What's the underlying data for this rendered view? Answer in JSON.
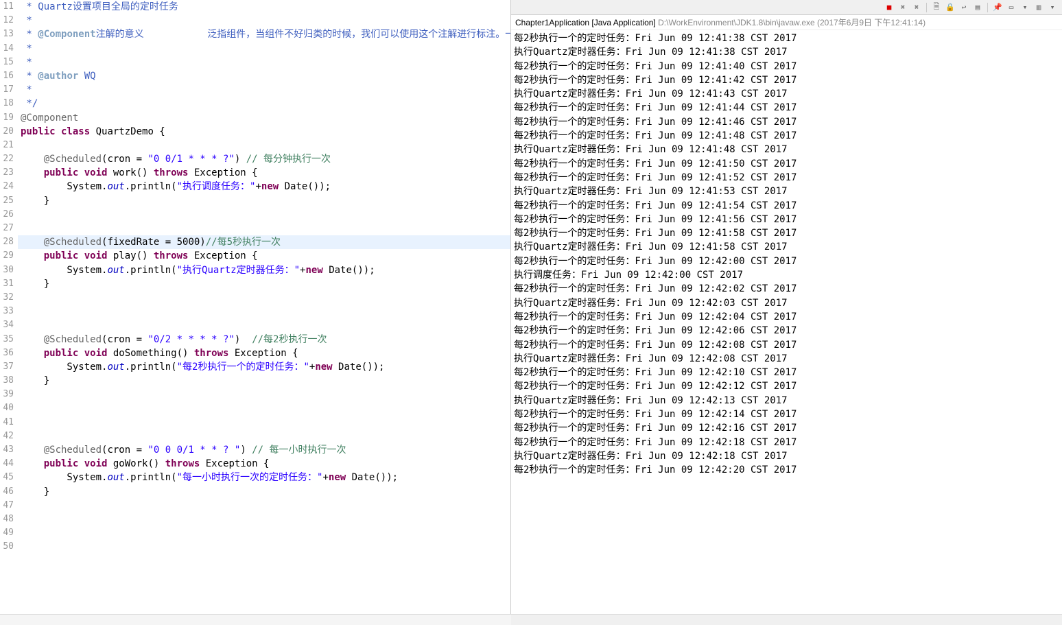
{
  "gutter": {
    "start": 11,
    "end": 50
  },
  "code": [
    {
      "n": 11,
      "segs": [
        {
          "c": "jd",
          "t": " * Quartz设置项目全局的定时任务"
        }
      ]
    },
    {
      "n": 12,
      "segs": [
        {
          "c": "jd",
          "t": " * "
        }
      ]
    },
    {
      "n": 13,
      "segs": [
        {
          "c": "jd",
          "t": " * "
        },
        {
          "c": "jdtag",
          "t": "@Component"
        },
        {
          "c": "jd",
          "t": "注解的意义           泛指组件，当组件不好归类的时候，我们可以使用这个注解进行标注。一般"
        }
      ]
    },
    {
      "n": 14,
      "segs": [
        {
          "c": "jd",
          "t": " * "
        }
      ]
    },
    {
      "n": 15,
      "segs": [
        {
          "c": "jd",
          "t": " * "
        }
      ]
    },
    {
      "n": 16,
      "segs": [
        {
          "c": "jd",
          "t": " * "
        },
        {
          "c": "jdtag",
          "t": "@author"
        },
        {
          "c": "jd",
          "t": " WQ"
        }
      ]
    },
    {
      "n": 17,
      "segs": [
        {
          "c": "jd",
          "t": " *"
        }
      ]
    },
    {
      "n": 18,
      "segs": [
        {
          "c": "jd",
          "t": " */"
        }
      ]
    },
    {
      "n": 19,
      "segs": [
        {
          "c": "ann",
          "t": "@Component"
        }
      ]
    },
    {
      "n": 20,
      "segs": [
        {
          "c": "kw",
          "t": "public class"
        },
        {
          "c": "plain",
          "t": " QuartzDemo {"
        }
      ]
    },
    {
      "n": 21,
      "segs": []
    },
    {
      "n": 22,
      "segs": [
        {
          "c": "plain",
          "t": "    "
        },
        {
          "c": "ann",
          "t": "@Scheduled"
        },
        {
          "c": "plain",
          "t": "(cron = "
        },
        {
          "c": "str",
          "t": "\"0 0/1 * * * ?\""
        },
        {
          "c": "plain",
          "t": ") "
        },
        {
          "c": "cmt",
          "t": "// 每分钟执行一次"
        }
      ]
    },
    {
      "n": 23,
      "segs": [
        {
          "c": "plain",
          "t": "    "
        },
        {
          "c": "kw",
          "t": "public void"
        },
        {
          "c": "plain",
          "t": " work() "
        },
        {
          "c": "kw",
          "t": "throws"
        },
        {
          "c": "plain",
          "t": " Exception {"
        }
      ]
    },
    {
      "n": 24,
      "segs": [
        {
          "c": "plain",
          "t": "        System."
        },
        {
          "c": "itl",
          "t": "out"
        },
        {
          "c": "plain",
          "t": ".println("
        },
        {
          "c": "str",
          "t": "\"执行调度任务：\""
        },
        {
          "c": "plain",
          "t": "+"
        },
        {
          "c": "kw",
          "t": "new"
        },
        {
          "c": "plain",
          "t": " Date());"
        }
      ]
    },
    {
      "n": 25,
      "segs": [
        {
          "c": "plain",
          "t": "    }"
        }
      ]
    },
    {
      "n": 26,
      "segs": []
    },
    {
      "n": 27,
      "segs": []
    },
    {
      "n": 28,
      "hl": true,
      "segs": [
        {
          "c": "plain",
          "t": "    "
        },
        {
          "c": "ann",
          "t": "@Scheduled"
        },
        {
          "c": "plain",
          "t": "(fixedRate = 5000)"
        },
        {
          "c": "cmt",
          "t": "//每5秒执行一次"
        }
      ]
    },
    {
      "n": 29,
      "segs": [
        {
          "c": "plain",
          "t": "    "
        },
        {
          "c": "kw",
          "t": "public void"
        },
        {
          "c": "plain",
          "t": " play() "
        },
        {
          "c": "kw",
          "t": "throws"
        },
        {
          "c": "plain",
          "t": " Exception {"
        }
      ]
    },
    {
      "n": 30,
      "segs": [
        {
          "c": "plain",
          "t": "        System."
        },
        {
          "c": "itl",
          "t": "out"
        },
        {
          "c": "plain",
          "t": ".println("
        },
        {
          "c": "str",
          "t": "\"执行Quartz定时器任务：\""
        },
        {
          "c": "plain",
          "t": "+"
        },
        {
          "c": "kw",
          "t": "new"
        },
        {
          "c": "plain",
          "t": " Date());"
        }
      ]
    },
    {
      "n": 31,
      "segs": [
        {
          "c": "plain",
          "t": "    }"
        }
      ]
    },
    {
      "n": 32,
      "segs": []
    },
    {
      "n": 33,
      "segs": []
    },
    {
      "n": 34,
      "segs": []
    },
    {
      "n": 35,
      "segs": [
        {
          "c": "plain",
          "t": "    "
        },
        {
          "c": "ann",
          "t": "@Scheduled"
        },
        {
          "c": "plain",
          "t": "(cron = "
        },
        {
          "c": "str",
          "t": "\"0/2 * * * * ?\""
        },
        {
          "c": "plain",
          "t": ")  "
        },
        {
          "c": "cmt",
          "t": "//每2秒执行一次"
        }
      ]
    },
    {
      "n": 36,
      "segs": [
        {
          "c": "plain",
          "t": "    "
        },
        {
          "c": "kw",
          "t": "public void"
        },
        {
          "c": "plain",
          "t": " doSomething() "
        },
        {
          "c": "kw",
          "t": "throws"
        },
        {
          "c": "plain",
          "t": " Exception {"
        }
      ]
    },
    {
      "n": 37,
      "segs": [
        {
          "c": "plain",
          "t": "        System."
        },
        {
          "c": "itl",
          "t": "out"
        },
        {
          "c": "plain",
          "t": ".println("
        },
        {
          "c": "str",
          "t": "\"每2秒执行一个的定时任务：\""
        },
        {
          "c": "plain",
          "t": "+"
        },
        {
          "c": "kw",
          "t": "new"
        },
        {
          "c": "plain",
          "t": " Date());"
        }
      ]
    },
    {
      "n": 38,
      "segs": [
        {
          "c": "plain",
          "t": "    }"
        }
      ]
    },
    {
      "n": 39,
      "segs": []
    },
    {
      "n": 40,
      "segs": []
    },
    {
      "n": 41,
      "segs": []
    },
    {
      "n": 42,
      "segs": []
    },
    {
      "n": 43,
      "segs": [
        {
          "c": "plain",
          "t": "    "
        },
        {
          "c": "ann",
          "t": "@Scheduled"
        },
        {
          "c": "plain",
          "t": "(cron = "
        },
        {
          "c": "str",
          "t": "\"0 0 0/1 * * ? \""
        },
        {
          "c": "plain",
          "t": ") "
        },
        {
          "c": "cmt",
          "t": "// 每一小时执行一次"
        }
      ]
    },
    {
      "n": 44,
      "segs": [
        {
          "c": "plain",
          "t": "    "
        },
        {
          "c": "kw",
          "t": "public void"
        },
        {
          "c": "plain",
          "t": " goWork() "
        },
        {
          "c": "kw",
          "t": "throws"
        },
        {
          "c": "plain",
          "t": " Exception {"
        }
      ]
    },
    {
      "n": 45,
      "segs": [
        {
          "c": "plain",
          "t": "        System."
        },
        {
          "c": "itl",
          "t": "out"
        },
        {
          "c": "plain",
          "t": ".println("
        },
        {
          "c": "str",
          "t": "\"每一小时执行一次的定时任务：\""
        },
        {
          "c": "plain",
          "t": "+"
        },
        {
          "c": "kw",
          "t": "new"
        },
        {
          "c": "plain",
          "t": " Date());"
        }
      ]
    },
    {
      "n": 46,
      "segs": [
        {
          "c": "plain",
          "t": "    }"
        }
      ]
    },
    {
      "n": 47,
      "segs": []
    },
    {
      "n": 48,
      "segs": []
    },
    {
      "n": 49,
      "segs": []
    },
    {
      "n": 50,
      "segs": []
    }
  ],
  "console": {
    "header_app": "Chapter1Application [Java Application]",
    "header_path": " D:\\WorkEnvironment\\JDK1.8\\bin\\javaw.exe (2017年6月9日 下午12:41:14)",
    "lines": [
      "每2秒执行一个的定时任务：Fri Jun 09 12:41:38 CST 2017",
      "执行Quartz定时器任务：Fri Jun 09 12:41:38 CST 2017",
      "每2秒执行一个的定时任务：Fri Jun 09 12:41:40 CST 2017",
      "每2秒执行一个的定时任务：Fri Jun 09 12:41:42 CST 2017",
      "执行Quartz定时器任务：Fri Jun 09 12:41:43 CST 2017",
      "每2秒执行一个的定时任务：Fri Jun 09 12:41:44 CST 2017",
      "每2秒执行一个的定时任务：Fri Jun 09 12:41:46 CST 2017",
      "每2秒执行一个的定时任务：Fri Jun 09 12:41:48 CST 2017",
      "执行Quartz定时器任务：Fri Jun 09 12:41:48 CST 2017",
      "每2秒执行一个的定时任务：Fri Jun 09 12:41:50 CST 2017",
      "每2秒执行一个的定时任务：Fri Jun 09 12:41:52 CST 2017",
      "执行Quartz定时器任务：Fri Jun 09 12:41:53 CST 2017",
      "每2秒执行一个的定时任务：Fri Jun 09 12:41:54 CST 2017",
      "每2秒执行一个的定时任务：Fri Jun 09 12:41:56 CST 2017",
      "每2秒执行一个的定时任务：Fri Jun 09 12:41:58 CST 2017",
      "执行Quartz定时器任务：Fri Jun 09 12:41:58 CST 2017",
      "每2秒执行一个的定时任务：Fri Jun 09 12:42:00 CST 2017",
      "执行调度任务：Fri Jun 09 12:42:00 CST 2017",
      "每2秒执行一个的定时任务：Fri Jun 09 12:42:02 CST 2017",
      "执行Quartz定时器任务：Fri Jun 09 12:42:03 CST 2017",
      "每2秒执行一个的定时任务：Fri Jun 09 12:42:04 CST 2017",
      "每2秒执行一个的定时任务：Fri Jun 09 12:42:06 CST 2017",
      "每2秒执行一个的定时任务：Fri Jun 09 12:42:08 CST 2017",
      "执行Quartz定时器任务：Fri Jun 09 12:42:08 CST 2017",
      "每2秒执行一个的定时任务：Fri Jun 09 12:42:10 CST 2017",
      "每2秒执行一个的定时任务：Fri Jun 09 12:42:12 CST 2017",
      "执行Quartz定时器任务：Fri Jun 09 12:42:13 CST 2017",
      "每2秒执行一个的定时任务：Fri Jun 09 12:42:14 CST 2017",
      "每2秒执行一个的定时任务：Fri Jun 09 12:42:16 CST 2017",
      "每2秒执行一个的定时任务：Fri Jun 09 12:42:18 CST 2017",
      "执行Quartz定时器任务：Fri Jun 09 12:42:18 CST 2017",
      "每2秒执行一个的定时任务：Fri Jun 09 12:42:20 CST 2017"
    ]
  },
  "toolbar_icons": [
    {
      "name": "terminate-icon",
      "glyph": "■",
      "color": "#d00"
    },
    {
      "name": "terminate-all-icon",
      "glyph": "✖",
      "color": "#888"
    },
    {
      "name": "remove-launch-icon",
      "glyph": "✖",
      "color": "#888"
    },
    {
      "name": "sep"
    },
    {
      "name": "clear-console-icon",
      "glyph": "🗎",
      "color": "#666"
    },
    {
      "name": "scroll-lock-icon",
      "glyph": "🔒",
      "color": "#666"
    },
    {
      "name": "word-wrap-icon",
      "glyph": "↩",
      "color": "#666"
    },
    {
      "name": "show-console-icon",
      "glyph": "▤",
      "color": "#666"
    },
    {
      "name": "sep"
    },
    {
      "name": "pin-console-icon",
      "glyph": "📌",
      "color": "#666"
    },
    {
      "name": "display-selected-icon",
      "glyph": "▭",
      "color": "#666"
    },
    {
      "name": "dropdown-icon",
      "glyph": "▾",
      "color": "#666"
    },
    {
      "name": "new-console-icon",
      "glyph": "▥",
      "color": "#666"
    },
    {
      "name": "menu-icon",
      "glyph": "▾",
      "color": "#666"
    }
  ]
}
